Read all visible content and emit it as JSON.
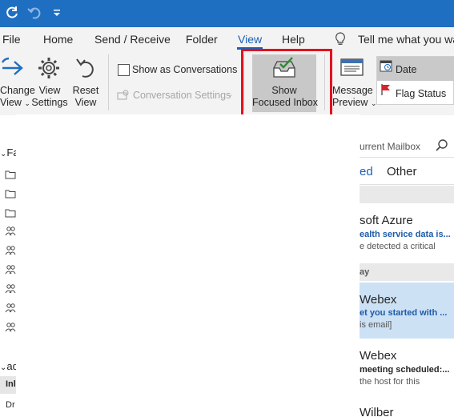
{
  "quick_access": {
    "icons": [
      "sync-icon",
      "undo-icon",
      "customize-qat-icon"
    ]
  },
  "menu": {
    "items": [
      "File",
      "Home",
      "Send / Receive",
      "Folder",
      "View",
      "Help"
    ],
    "active": "View",
    "tell_me": "Tell me what you war"
  },
  "ribbon": {
    "change_view": [
      "Change",
      "View"
    ],
    "view_settings": [
      "View",
      "Settings"
    ],
    "reset_view": [
      "Reset",
      "View"
    ],
    "show_as_conversations": "Show as Conversations",
    "conversation_settings": "Conversation Settings",
    "show_focused_inbox": [
      "Show",
      "Focused Inbox"
    ],
    "message_preview": [
      "Message",
      "Preview"
    ],
    "sort_date": "Date",
    "sort_flag_status": "Flag Status"
  },
  "folder_pane": {
    "favorites_label": "Fa",
    "account_label": "ad",
    "inbox_label": "Inl",
    "drafts_label": "Dr"
  },
  "message_list": {
    "search_scope": "urrent Mailbox",
    "tab_focused": "ed",
    "tab_other": "Other",
    "date_header_yesterday": "ay",
    "messages": [
      {
        "sender": "soft Azure",
        "subject": "ealth service data is...",
        "preview": "e detected a critical"
      },
      {
        "sender": "Webex",
        "subject": "et you started with ...",
        "preview": "is email]"
      },
      {
        "sender": "Webex",
        "subject": "meeting scheduled:...",
        "preview": "the host for this"
      },
      {
        "sender": "Wilber",
        "subject": "",
        "preview": ""
      }
    ]
  },
  "colors": {
    "titlebar": "#1e6fc2",
    "accent": "#1b5fb5",
    "highlight_frame": "#e3121d",
    "selected_row": "#cde1f5"
  }
}
